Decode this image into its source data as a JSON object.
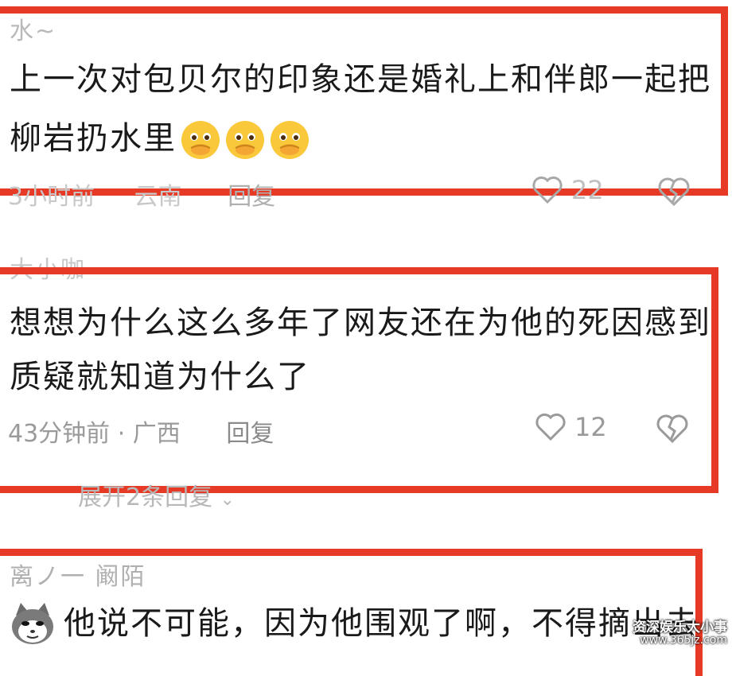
{
  "comments": [
    {
      "username": "水~",
      "line1": "上一次对包贝尔的印象还是婚礼上和伴郎一起把",
      "line2": "柳岩扔水里",
      "emoji_name": "crying-hands-emoji",
      "time": "3小时前",
      "location": "云南",
      "reply_label": "回复",
      "likes": "22"
    },
    {
      "username": "大小咖~",
      "line1": "想想为什么这么多年了网友还在为他的死因感到",
      "line2": "质疑就知道为什么了",
      "time": "43分钟前 · 广西",
      "reply_label": "回复",
      "likes": "12",
      "expand_label": "展开2条回复"
    },
    {
      "username": "离ノ一 阚陌",
      "line1": "他说不可能，因为他围观了啊，不得摘出去"
    }
  ],
  "watermark": {
    "line1": "资深娱乐大小事",
    "line2": "www.365jz.com"
  },
  "colors": {
    "highlight_border": "#e63a26",
    "meta_text": "#9a9a9a"
  }
}
